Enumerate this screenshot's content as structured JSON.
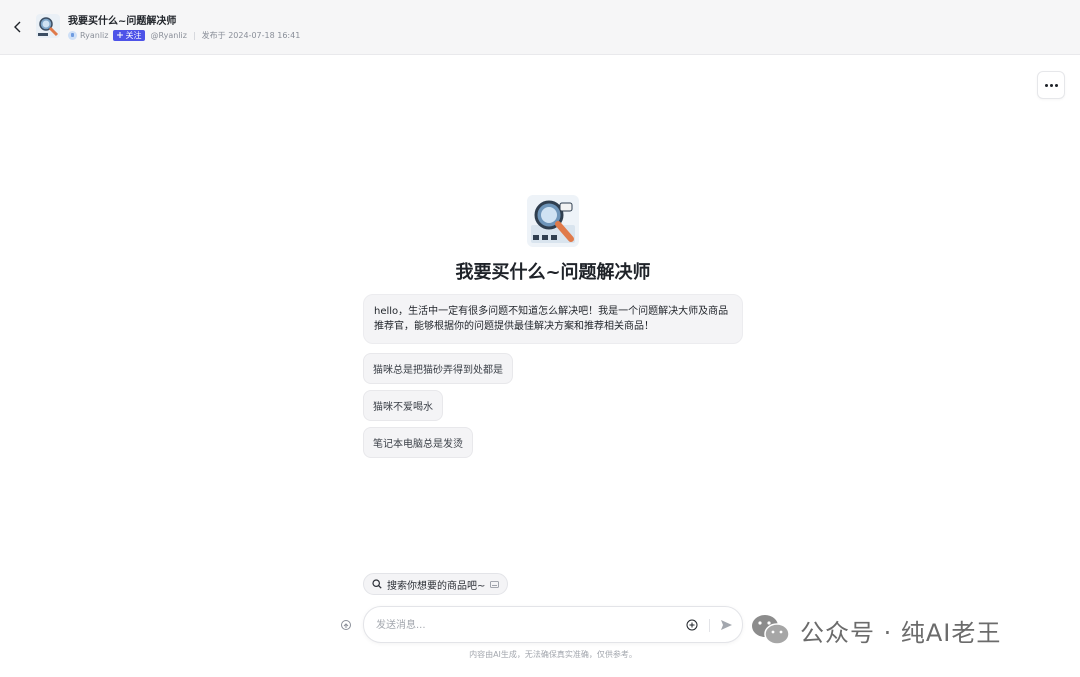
{
  "header": {
    "title": "我要买什么~问题解决师",
    "author": "Ryanliz",
    "follow_label": "关注",
    "handle": "@Ryanliz",
    "published": "发布于 2024-07-18 16:41"
  },
  "bot": {
    "name": "我要买什么~问题解决师",
    "greeting": "hello，生活中一定有很多问题不知道怎么解决吧！我是一个问题解决大师及商品推荐官，能够根据你的问题提供最佳解决方案和推荐相关商品！",
    "suggestions": [
      "猫咪总是把猫砂弄得到处都是",
      "猫咪不爱喝水",
      "笔记本电脑总是发烫"
    ]
  },
  "plugin_chip": {
    "label": "搜索你想要的商品吧~"
  },
  "input": {
    "placeholder": "发送消息..."
  },
  "disclaimer": "内容由AI生成，无法确保真实准确，仅供参考。",
  "watermark": {
    "text": "公众号 · 纯AI老王",
    "icon": "wechat-icon"
  },
  "colors": {
    "accent": "#4d53e8",
    "header_bg": "#f6f6f7",
    "bubble_bg": "#f4f4f6"
  }
}
